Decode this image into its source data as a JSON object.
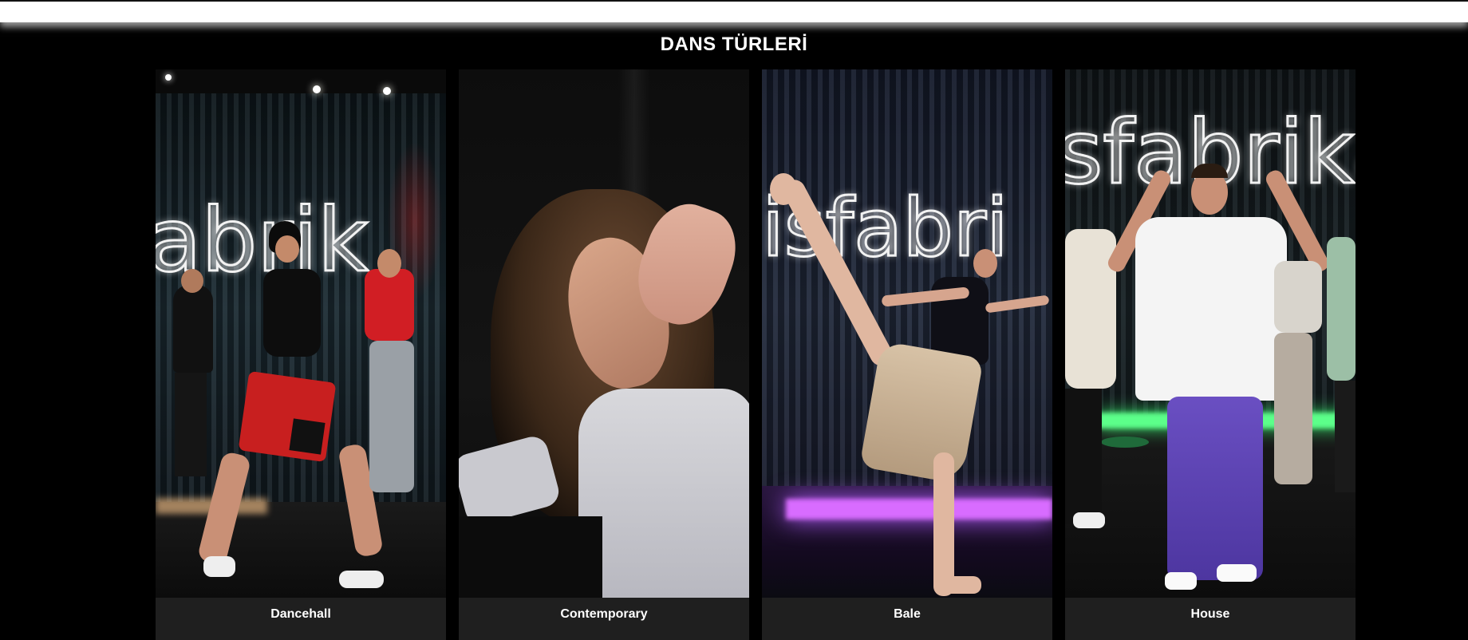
{
  "header": {
    "title": "DANS TÜRLERİ"
  },
  "cards": [
    {
      "label": "Dancehall",
      "sign": "abrik"
    },
    {
      "label": "Contemporary"
    },
    {
      "label": "Bale",
      "sign": "isfabri"
    },
    {
      "label": "House",
      "sign": "sfabrika"
    }
  ],
  "colors": {
    "background": "#000000",
    "card": "#1f1f1f",
    "text": "#ffffff"
  }
}
